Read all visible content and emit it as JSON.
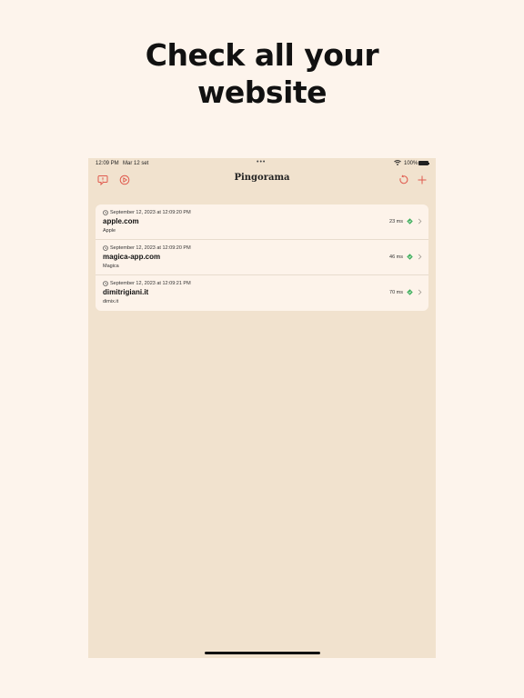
{
  "headline": {
    "line1": "Check all your",
    "line2": "website"
  },
  "status_bar": {
    "time": "12:09 PM",
    "date": "Mar 12 set",
    "dots": "•••",
    "battery": "100%"
  },
  "nav": {
    "title": "Pingorama"
  },
  "sites": [
    {
      "timestamp": "September 12, 2023 at 12:09:20 PM",
      "host": "apple.com",
      "name": "Apple",
      "latency": "23 ms"
    },
    {
      "timestamp": "September 12, 2023 at 12:09:20 PM",
      "host": "magica-app.com",
      "name": "Magica",
      "latency": "46 ms"
    },
    {
      "timestamp": "September 12, 2023 at 12:09:21 PM",
      "host": "dimitrigiani.it",
      "name": "dimix.it",
      "latency": "70 ms"
    }
  ],
  "colors": {
    "accent": "#e05a4e",
    "status_ok": "#3fae5c",
    "background": "#fdf4ec",
    "app_background": "#f1e2ce",
    "card": "#fdf3ea"
  }
}
